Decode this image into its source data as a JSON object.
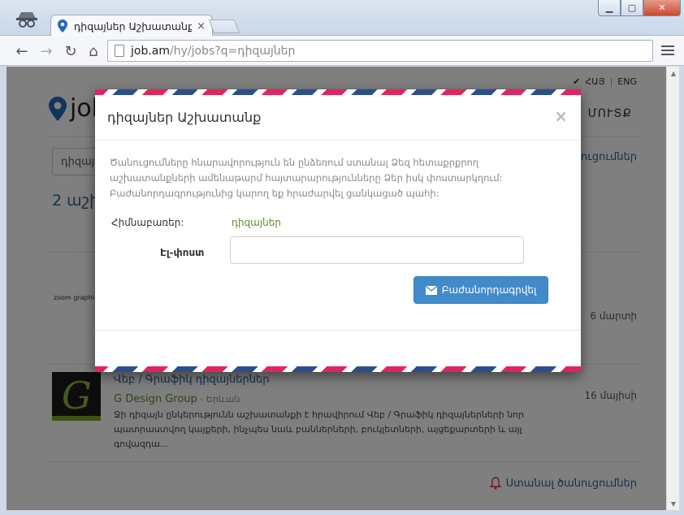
{
  "browser": {
    "tab_title": "դիզայներ Աշխատանք",
    "tab_close": "×",
    "url_host": "job.am",
    "url_path": "/hy/jobs?q=դիզայներ",
    "window_buttons": {
      "minimize": "▁",
      "maximize": "▢",
      "close": "✕"
    },
    "nav": {
      "back": "←",
      "forward": "→",
      "reload": "↻",
      "home": "⌂"
    }
  },
  "page": {
    "lang_hy": "ՀԱՅ",
    "lang_sep": "|",
    "lang_en": "ENG",
    "logo_text": "job",
    "login": "ՄՈՒՏՔ",
    "search_value": "դիզայ",
    "notify_link_top": "ծանուցումներ",
    "results_count": "2 աշխ",
    "job1": {
      "logo_text": "zoom graphics",
      "date": "6 մարտի"
    },
    "job2": {
      "logo_letter": "G",
      "title": "Վեբ / Գրաֆիկ դիզայներներ",
      "company": "G Design Group",
      "city": " - Երևան",
      "description": "Ջի դիզայն ընկերությունն աշխատանքի է հրավիրում Վեբ / Գրաֆիկ դիզայներների նոր պատրաստվող կայքերի, ինչպես նաև բաններների, բուկլետների, այցեքարտերի և այլ գովազդա...",
      "date": "16 մայիսի"
    },
    "bottom_notify": "Ստանալ ծանուցումներ"
  },
  "modal": {
    "title": "դիզայներ Աշխատանք",
    "close": "×",
    "description": "Ծանուցումները հնարավորություն են ընձեռում ստանալ Ձեզ հետաքրքրող աշխատանքների ամենաթարմ հայտարարությունները Ձեր իսկ փոստարկղում: Բաժանորդագրությունից կարող եք հրաժարվել ցանկացած պահի:",
    "keyword_label": "Հիմնաբառեր:",
    "keyword_value": "դիզայներ",
    "email_label": "Էլ-փոստ",
    "email_value": "",
    "subscribe_label": "Բաժանորդագրվել"
  },
  "colors": {
    "link": "#2a6496",
    "accent_green": "#5a8a2a",
    "primary_button": "#428bca",
    "airmail_red": "#e0245e",
    "airmail_blue": "#2c4f8c"
  },
  "icons": [
    "incognito-icon",
    "map-pin-icon",
    "back-icon",
    "forward-icon",
    "reload-icon",
    "home-icon",
    "page-icon",
    "menu-icon",
    "envelope-icon",
    "bell-icon",
    "checkmark-icon",
    "close-icon"
  ]
}
